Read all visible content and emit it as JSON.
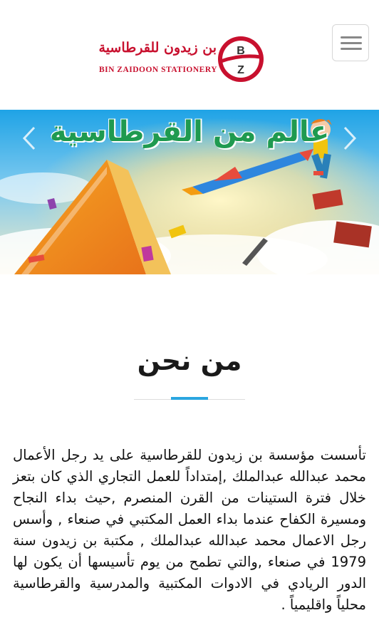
{
  "header": {
    "logo_arabic": "بن زيدون للقرطاسية",
    "logo_english": "BIN ZAIDOON STATIONERY",
    "logo_mark_letters": [
      "B",
      "Z"
    ],
    "menu_button_icon": "hamburger-menu-icon"
  },
  "banner": {
    "headline": "عالم من القرطاسية",
    "prev_icon": "chevron-left-icon",
    "next_icon": "chevron-right-icon"
  },
  "about": {
    "title": "من نحن",
    "body": "تأسست مؤسسة بن زيدون للقرطاسية على يد رجل الأعمال محمد عبدالله عبدالملك ,إمتداداً للعمل التجاري الذي كان بتعز خلال فترة الستينات من القرن المنصرم ,حيث بداء النجاح ومسيرة الكفاح عندما بداء العمل المكتبي في صنعاء , وأسس رجل الاعمال محمد عبدالله عبدالملك , مكتبة بن زيدون سنة 1979 في صنعاء ,والتي تطمح من يوم تأسيسها أن يكون لها الدور الريادي في الادوات المكتبية والمدرسية والقرطاسية محلياً واقليمياً ."
  },
  "colors": {
    "brand_red": "#c8102e",
    "headline_green": "#1f9a50",
    "divider_accent": "#2aa6e0"
  }
}
